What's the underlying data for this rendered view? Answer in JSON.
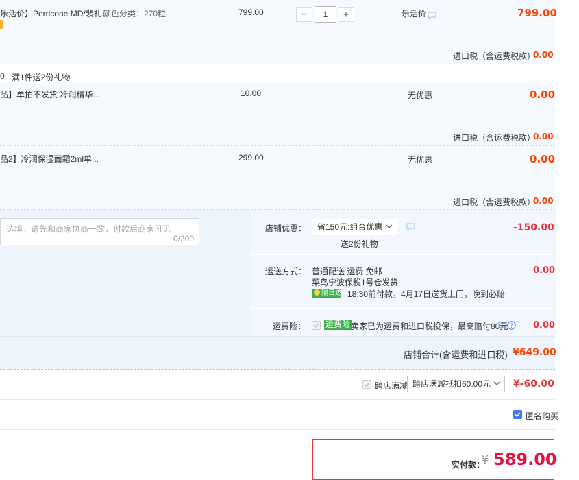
{
  "items": [
    {
      "title": "乐活价】Perricone MD/裴礼...",
      "sku": "颜色分类：270粒",
      "unit_price": "799.00",
      "quantity": "1",
      "discount": "乐活价",
      "subtotal": "799.00",
      "tax_label": "进口税（含运费税款）",
      "tax_value": "0.00"
    },
    {
      "title": "品】单拍不发货 冷润精华...",
      "unit_price": "10.00",
      "discount": "无优惠",
      "subtotal": "0.00",
      "tax_label": "进口税（含运费税款）",
      "tax_value": "0.00"
    },
    {
      "title": "品2】冷润保湿面霜2ml单...",
      "unit_price": "299.00",
      "discount": "无优惠",
      "subtotal": "0.00",
      "tax_label": "进口税（含运费税款）",
      "tax_value": "0.00"
    }
  ],
  "gift_promo": {
    "prefix": "0",
    "text": "满1件送2份礼物"
  },
  "message": {
    "placeholder": "选填，请先和商家协商一致，付款后商家可见",
    "counter": "0/200"
  },
  "shop_discount": {
    "label": "店铺优惠：",
    "selected": "省150元:组合优惠",
    "note": "送2份礼物",
    "value": "-150.00"
  },
  "shipping": {
    "label": "运送方式：",
    "method": "普通配送 运费 免邮",
    "warehouse": "菜鸟宁波保税1号仓",
    "warehouse_action": "发货",
    "badge": "隔日达",
    "eta": "18:30前付款，4月17日送货上门，晚到必赔",
    "value": "0.00"
  },
  "insurance": {
    "label": "运费险：",
    "badge": "运费险",
    "text": "卖家已为运费和进口税投保，最高赔付80元",
    "value": "0.00"
  },
  "shop_total": {
    "label": "店铺合计(含运费和进口税)",
    "value": "¥649.00"
  },
  "cross_store": {
    "label": "跨店满减",
    "selected": "跨店满减抵扣60.00元",
    "value": "¥-60.00"
  },
  "anonymous": {
    "label": "匿名购买"
  },
  "payment": {
    "label": "实付款：",
    "currency": "¥",
    "amount": "589.00"
  },
  "colors": {
    "accent_orange": "#ff4400",
    "accent_red": "#e4393c",
    "row_background": "#f5f8fd",
    "checkbox_blue": "#3c7cf3",
    "badge_green": "#3db04d"
  }
}
